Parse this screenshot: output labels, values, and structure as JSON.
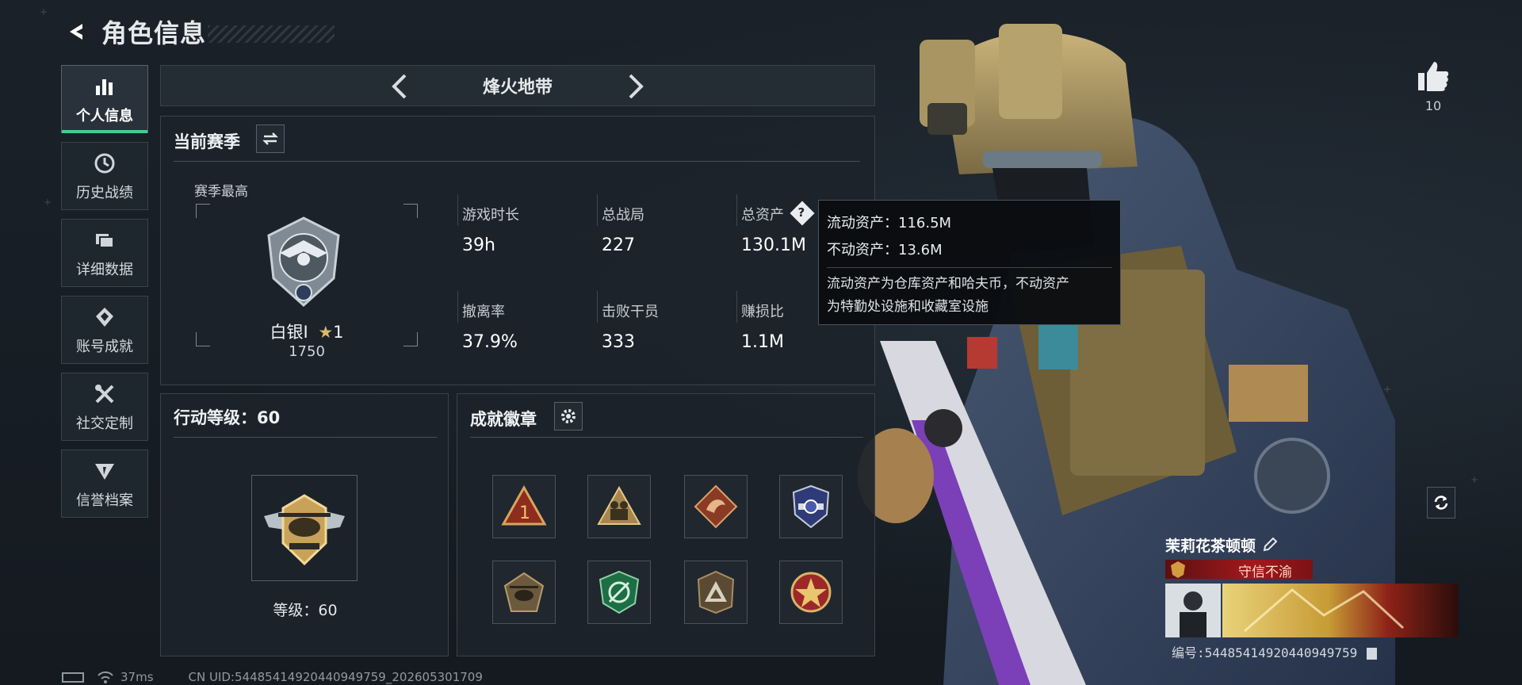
{
  "header": {
    "title": "角色信息"
  },
  "nav": {
    "items": [
      {
        "label": "个人信息",
        "icon": "bar-chart-icon",
        "active": true
      },
      {
        "label": "历史战绩",
        "icon": "clock-icon",
        "active": false
      },
      {
        "label": "详细数据",
        "icon": "folder-icon",
        "active": false
      },
      {
        "label": "账号成就",
        "icon": "achievement-icon",
        "active": false
      },
      {
        "label": "社交定制",
        "icon": "tools-icon",
        "active": false
      },
      {
        "label": "信誉档案",
        "icon": "credit-icon",
        "active": false
      }
    ]
  },
  "mode": {
    "title": "烽火地带"
  },
  "season": {
    "heading": "当前赛季",
    "best_label": "赛季最高",
    "rank_name": "白银I",
    "rank_stars": "1",
    "rank_score": "1750",
    "stats": [
      {
        "label": "游戏时长",
        "value": "39h"
      },
      {
        "label": "总战局",
        "value": "227"
      },
      {
        "label": "总资产",
        "value": "130.1M"
      },
      {
        "label": "撤离率",
        "value": "37.9%"
      },
      {
        "label": "击败干员",
        "value": "333"
      },
      {
        "label": "赚损比",
        "value": "1.1M"
      }
    ]
  },
  "tooltip": {
    "liquid": "流动资产：116.5M",
    "fixed": "不动资产：13.6M",
    "desc_line1": "流动资产为仓库资产和哈夫币，不动资产",
    "desc_line2": "为特勤处设施和收藏室设施"
  },
  "level": {
    "heading": "行动等级：60",
    "label": "等级：60"
  },
  "badges": {
    "heading": "成就徽章",
    "icons": [
      "rank-one-badge-icon",
      "soldiers-badge-icon",
      "dragon-badge-icon",
      "shield-badge-icon",
      "helicopter-badge-icon",
      "target-badge-icon",
      "triangle-badge-icon",
      "star-badge-icon"
    ]
  },
  "player": {
    "likes": "10",
    "name": "茉莉花茶顿顿",
    "title": "守信不渝",
    "id_text": "编号:54485414920440949759"
  },
  "status": {
    "ping": "37ms",
    "uid": "CN UID:54485414920440949759_202605301709"
  },
  "colors": {
    "accent": "#3ecf8e",
    "title_red": "#a3191d",
    "gold": "#c9a25a"
  }
}
